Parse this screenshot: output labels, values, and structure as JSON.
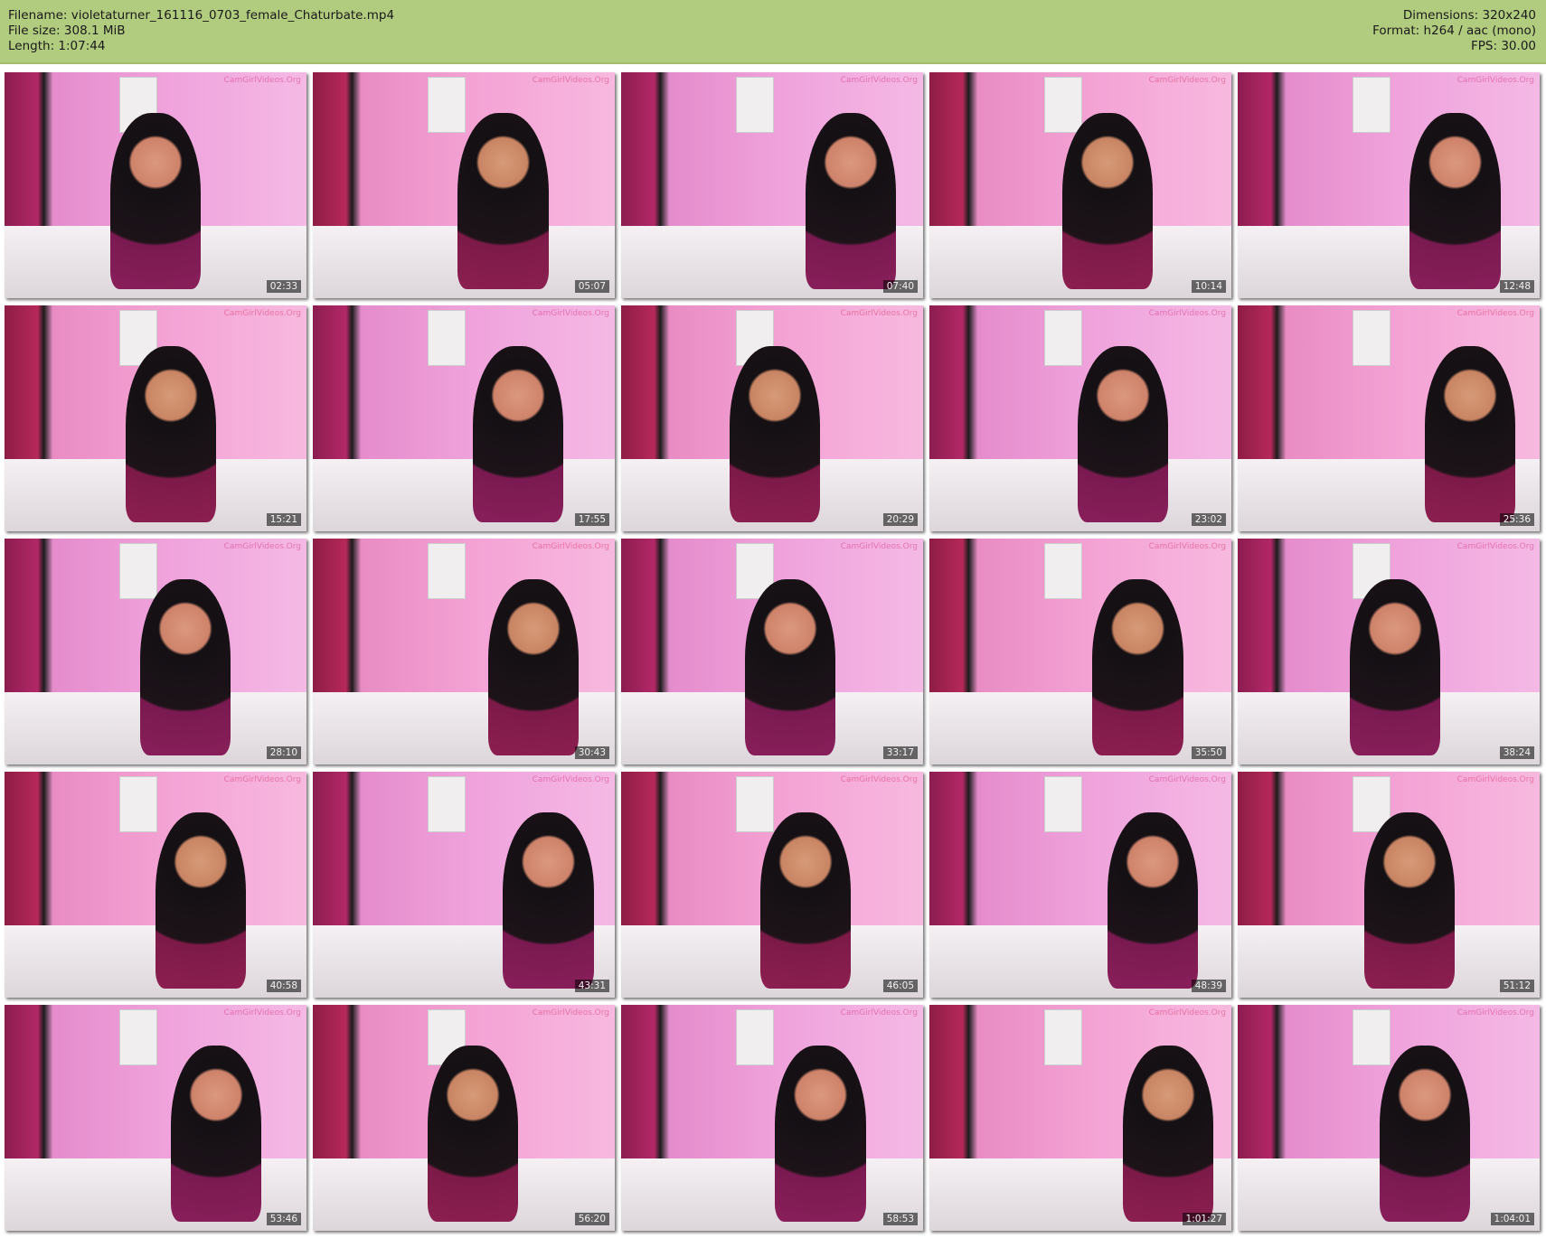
{
  "header": {
    "filename": "Filename: violetaturner_161116_0703_female_Chaturbate.mp4",
    "filesize": "File size: 308.1 MiB",
    "length": "Length: 1:07:44",
    "dimensions": "Dimensions: 320x240",
    "format": "Format: h264 / aac (mono)",
    "fps": "FPS: 30.00"
  },
  "colors": {
    "header_bg": "#b1cc7e"
  },
  "watermark": "CamGirlVideos.Org",
  "thumbnails": [
    "02:33",
    "05:07",
    "07:40",
    "10:14",
    "12:48",
    "15:21",
    "17:55",
    "20:29",
    "23:02",
    "25:36",
    "28:10",
    "30:43",
    "33:17",
    "35:50",
    "38:24",
    "40:58",
    "43:31",
    "46:05",
    "48:39",
    "51:12",
    "53:46",
    "56:20",
    "58:53",
    "1:01:27",
    "1:04:01"
  ]
}
